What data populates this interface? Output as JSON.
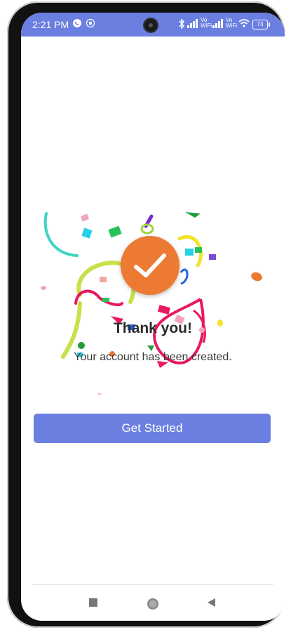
{
  "status_bar": {
    "time": "2:21 PM",
    "signal_labels": [
      "Vo",
      "WiFi",
      "Vo",
      "WiFi"
    ],
    "battery": "73",
    "background": "#6b7fe0",
    "icons": [
      "whatsapp-icon",
      "notification-icon",
      "camera-cutout",
      "bluetooth-icon",
      "signal-icon",
      "wifi-icon",
      "battery-icon"
    ]
  },
  "success": {
    "title": "Thank you!",
    "message": "Your account has been created.",
    "badge_color": "#ec7a33",
    "badge_icon": "check-icon"
  },
  "actions": {
    "get_started_label": "Get Started",
    "button_color": "#6b7fe0"
  },
  "nav_bar": {
    "icons": [
      "recent-apps-icon",
      "home-icon",
      "back-icon"
    ]
  }
}
